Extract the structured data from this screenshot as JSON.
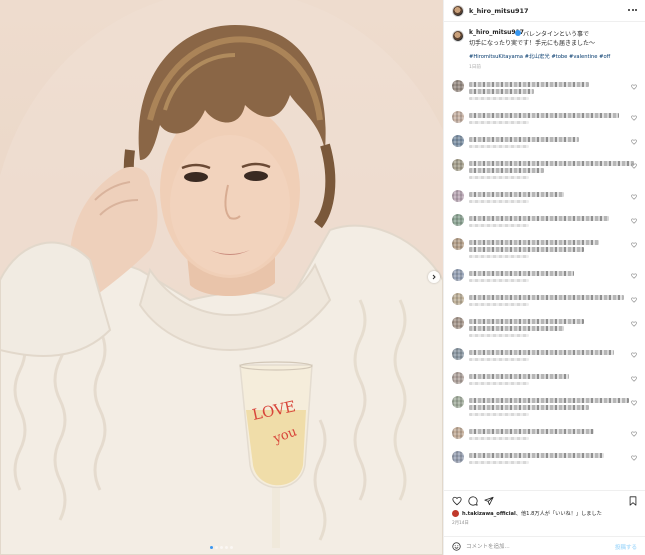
{
  "post": {
    "username": "k_hiro_mitsu917",
    "caption_line1": "バレンタインという事で",
    "caption_line2": "切手になったり実です！手元にも届きました〜",
    "hashtags": "#HiromitsuKitayama #北山宏光 #tobe #valentine #off",
    "caption_time": "1日前",
    "glass_text_1": "LOVE",
    "glass_text_2": "you",
    "image_count": 5,
    "active_image": 0
  },
  "actions": {
    "icons": [
      "heart-icon",
      "comment-icon",
      "share-icon",
      "bookmark-icon"
    ]
  },
  "likes": {
    "liker": "h.takizawa_official",
    "rest": "、他1.8万人が「いいね！」しました",
    "date": "2月14日"
  },
  "add_comment": {
    "placeholder": "コメントを追加...",
    "post_label": "投稿する"
  },
  "comments": {
    "count": 15
  },
  "colors": {
    "accent": "#3897f0",
    "hashtag": "#00376b",
    "background": "#ead6c6",
    "sweater": "#f3ede4"
  }
}
